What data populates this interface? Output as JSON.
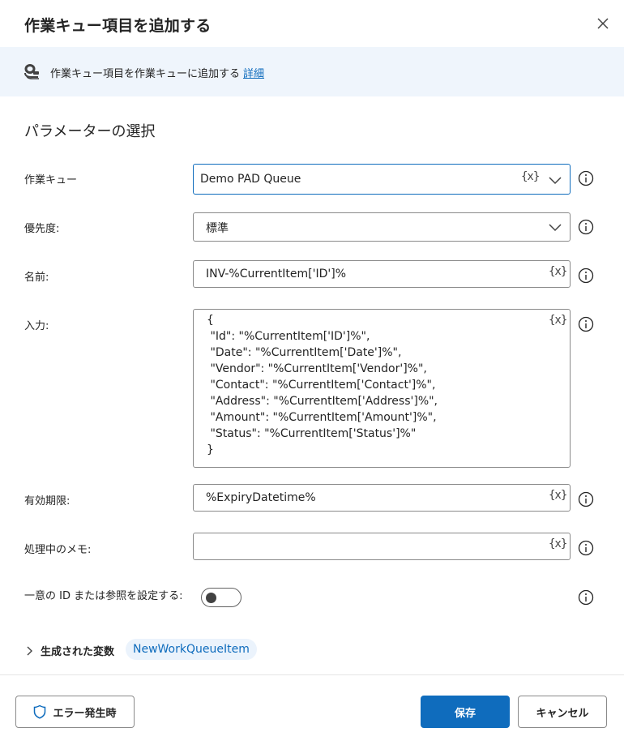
{
  "dialog": {
    "title": "作業キュー項目を追加する",
    "close_icon": "close-icon"
  },
  "info": {
    "icon": "work-queue-icon",
    "text": "作業キュー項目を作業キューに追加する",
    "link": "詳細"
  },
  "section_title": "パラメーターの選択",
  "fields": {
    "queue": {
      "label": "作業キュー",
      "value": "Demo PAD Queue",
      "var": "{x}"
    },
    "priority": {
      "label": "優先度:",
      "value": "標準"
    },
    "name": {
      "label": "名前:",
      "value": "INV-%CurrentItem['ID']%",
      "var": "{x}"
    },
    "input": {
      "label": "入力:",
      "value": "{\n \"Id\": \"%CurrentItem['ID']%\",\n \"Date\": \"%CurrentItem['Date']%\",\n \"Vendor\": \"%CurrentItem['Vendor']%\",\n \"Contact\": \"%CurrentItem['Contact']%\",\n \"Address\": \"%CurrentItem['Address']%\",\n \"Amount\": \"%CurrentItem['Amount']%\",\n \"Status\": \"%CurrentItem['Status']%\"\n}",
      "var": "{x}"
    },
    "expiry": {
      "label": "有効期限:",
      "value": "%ExpiryDatetime%",
      "var": "{x}"
    },
    "notes": {
      "label": "処理中のメモ:",
      "value": "",
      "var": "{x}"
    },
    "unique_id": {
      "label": "一意の ID または参照を設定する:",
      "toggle_on": false
    }
  },
  "generated": {
    "label": "生成された変数",
    "variable": "NewWorkQueueItem"
  },
  "footer": {
    "error_button": "エラー発生時",
    "save_button": "保存",
    "cancel_button": "キャンセル"
  },
  "colors": {
    "accent": "#0f6cbd",
    "info_bar": "#eff5fc",
    "chip_bg": "#ebf3fc"
  }
}
